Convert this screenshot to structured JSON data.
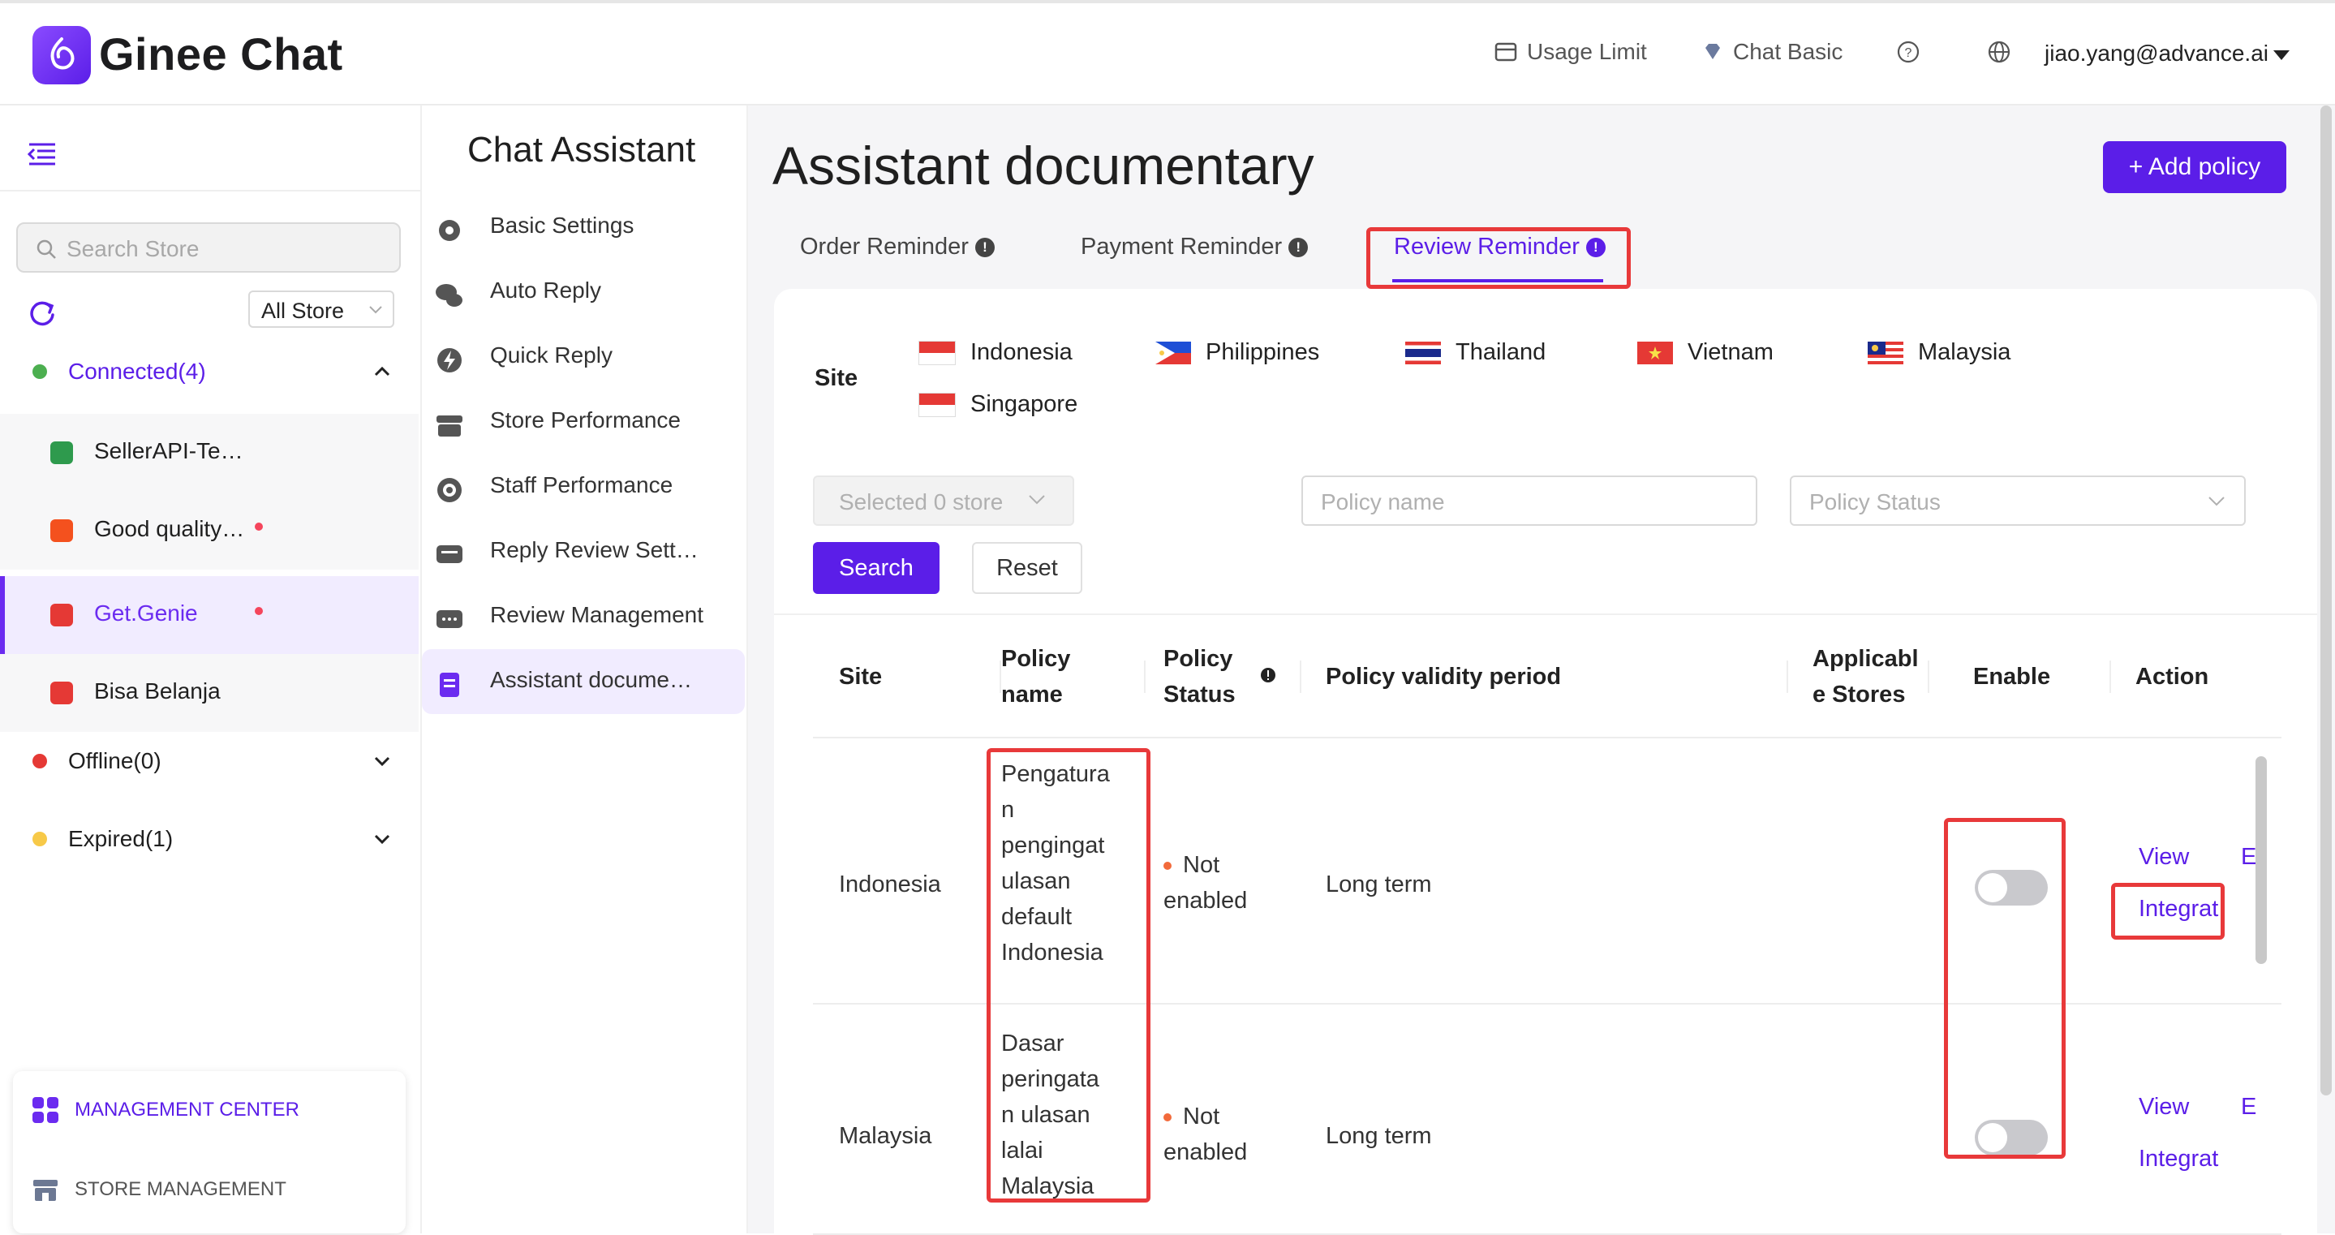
{
  "header": {
    "brand": "Ginee Chat",
    "usage_limit": "Usage Limit",
    "chat_basic": "Chat Basic",
    "user": "jiao.yang@advance.ai"
  },
  "store_sidebar": {
    "search_placeholder": "Search Store",
    "store_filter": "All Store",
    "connected_label": "Connected(4)",
    "stores": [
      {
        "name": "SellerAPI-Te…",
        "icon_color": "#2e9a4d"
      },
      {
        "name": "Good quality…",
        "icon_color": "#f4511e"
      },
      {
        "name": "Get.Genie",
        "icon_color": "#e53935"
      },
      {
        "name": "Bisa Belanja",
        "icon_color": "#e53935"
      }
    ],
    "offline_label": "Offline(0)",
    "expired_label": "Expired(1)",
    "management_center": "MANAGEMENT CENTER",
    "store_management": "STORE MANAGEMENT"
  },
  "assistant_menu": {
    "title": "Chat Assistant",
    "items": [
      {
        "label": "Basic Settings",
        "icon": "gear-icon"
      },
      {
        "label": "Auto Reply",
        "icon": "chat-bubbles-icon"
      },
      {
        "label": "Quick Reply",
        "icon": "lightning-bubble-icon"
      },
      {
        "label": "Store Performance",
        "icon": "store-icon"
      },
      {
        "label": "Staff Performance",
        "icon": "headset-icon"
      },
      {
        "label": "Reply Review Sett…",
        "icon": "message-icon"
      },
      {
        "label": "Review Management",
        "icon": "review-icon"
      },
      {
        "label": "Assistant docume…",
        "icon": "document-icon"
      }
    ]
  },
  "main": {
    "title": "Assistant documentary",
    "add_policy": "+ Add policy",
    "tabs": [
      "Order Reminder",
      "Payment Reminder",
      "Review Reminder"
    ],
    "active_tab": "Review Reminder",
    "site_label": "Site",
    "sites": [
      "Indonesia",
      "Philippines",
      "Thailand",
      "Vietnam",
      "Malaysia",
      "Singapore"
    ],
    "filters": {
      "store_placeholder": "Selected 0 store",
      "policy_name_placeholder": "Policy name",
      "policy_status_placeholder": "Policy Status",
      "search": "Search",
      "reset": "Reset"
    },
    "table": {
      "headers": {
        "site": "Site",
        "policy_name_1": "Policy",
        "policy_name_2": "name",
        "policy_status_1": "Policy",
        "policy_status_2": "Status",
        "validity": "Policy validity period",
        "stores_1": "Applicabl",
        "stores_2": "e Stores",
        "enable": "Enable",
        "action": "Action"
      },
      "rows": [
        {
          "site": "Indonesia",
          "policy_lines": [
            "Pengatura",
            "n",
            "pengingat",
            "ulasan",
            "default",
            "Indonesia"
          ],
          "status_1": "Not",
          "status_2": "enabled",
          "validity": "Long term",
          "enabled": false,
          "view": "View",
          "edit": "E",
          "integrate": "Integrat"
        },
        {
          "site": "Malaysia",
          "policy_lines": [
            "Dasar",
            "peringata",
            "n ulasan",
            "lalai",
            "Malaysia"
          ],
          "status_1": "Not",
          "status_2": "enabled",
          "validity": "Long term",
          "enabled": false,
          "view": "View",
          "edit": "E",
          "integrate": "Integrat"
        }
      ]
    }
  },
  "colors": {
    "accent": "#5b1ee8",
    "highlight": "#e8393a"
  }
}
